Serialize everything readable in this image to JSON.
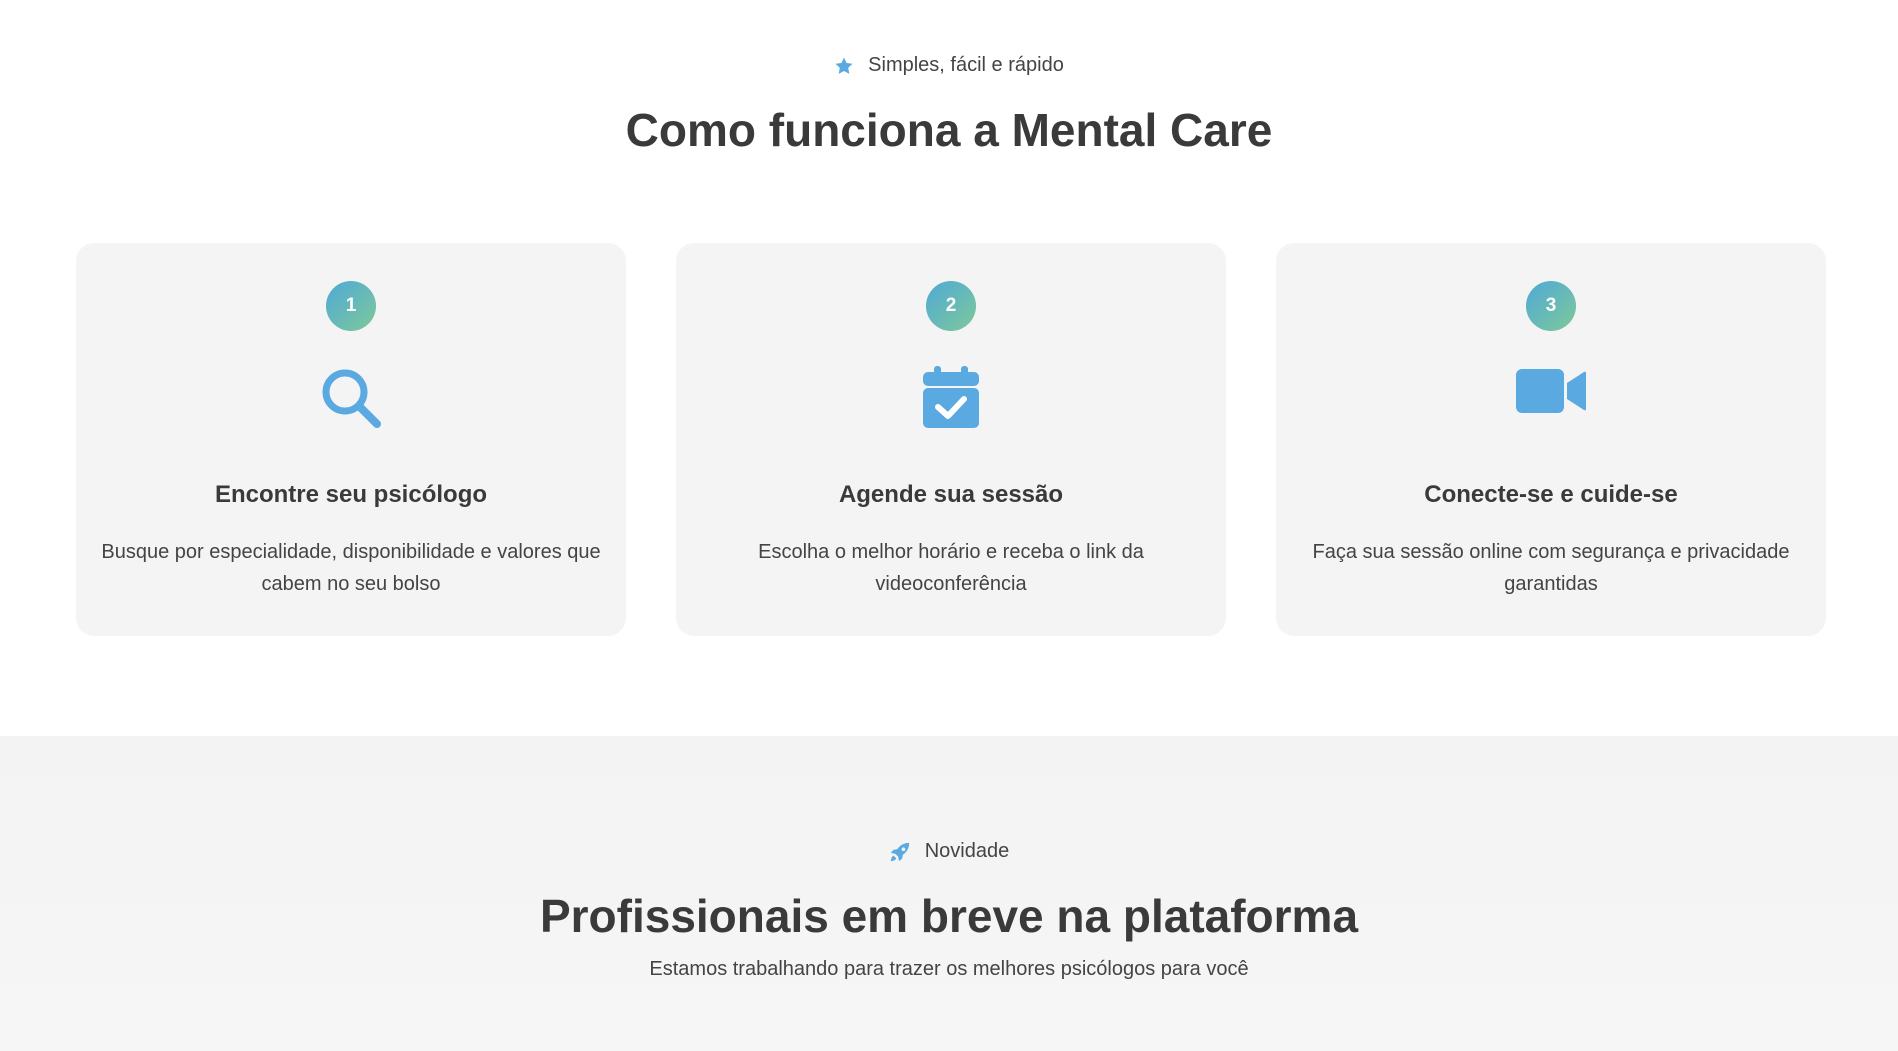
{
  "progress": {
    "fraction": 0.2
  },
  "how_it_works": {
    "eyebrow": {
      "text": "Simples, fácil e rápido",
      "icon": "star-icon"
    },
    "title": "Como funciona a Mental Care",
    "steps": [
      {
        "number": "1",
        "icon": "search-icon",
        "title": "Encontre seu psicólogo",
        "description": "Busque por especialidade, disponibilidade e valores que cabem no seu bolso"
      },
      {
        "number": "2",
        "icon": "calendar-check-icon",
        "title": "Agende sua sessão",
        "description": "Escolha o melhor horário e receba o link da videoconferência"
      },
      {
        "number": "3",
        "icon": "video-camera-icon",
        "title": "Conecte-se e cuide-se",
        "description": "Faça sua sessão online com segurança e privacidade garantidas"
      }
    ]
  },
  "coming_soon": {
    "eyebrow": {
      "text": "Novidade",
      "icon": "rocket-icon"
    },
    "title": "Profissionais em breve na plataforma",
    "subtitle": "Estamos trabalhando para trazer os melhores psicólogos para você"
  },
  "colors": {
    "accent": "#5aa9e0",
    "badge_gradient_start": "#4fa9d6",
    "badge_gradient_end": "#7ec99a",
    "card_bg": "#f4f4f4",
    "text": "#3d3d3d"
  }
}
